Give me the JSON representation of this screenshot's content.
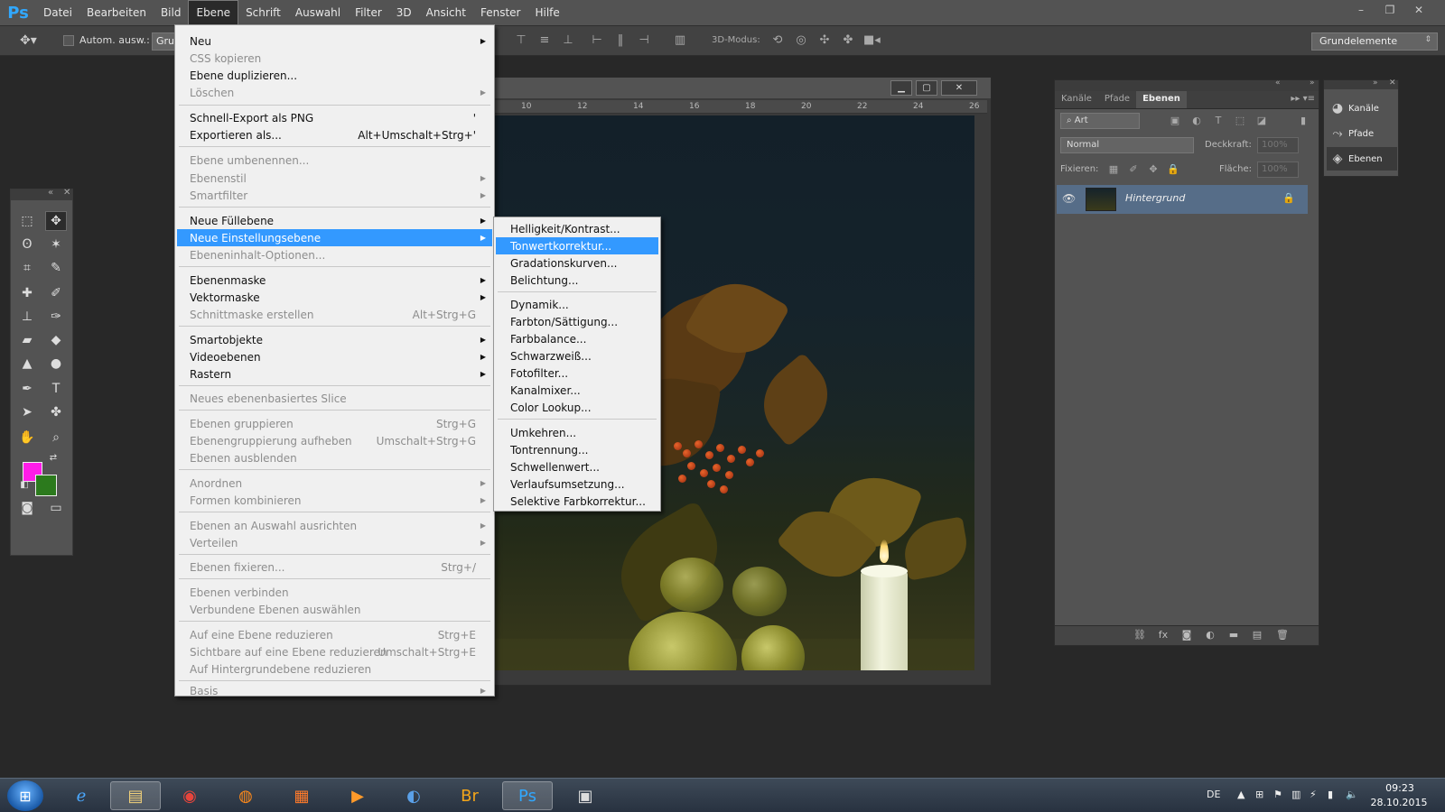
{
  "menubar": {
    "logo": "Ps",
    "items": [
      "Datei",
      "Bearbeiten",
      "Bild",
      "Ebene",
      "Schrift",
      "Auswahl",
      "Filter",
      "3D",
      "Ansicht",
      "Fenster",
      "Hilfe"
    ],
    "active_index": 3
  },
  "window_controls": [
    "–",
    "❐",
    "✕"
  ],
  "options": {
    "auto_select_label": "Autom. ausw.:",
    "group_value": "Grup",
    "mode_3d_label": "3D-Modus:",
    "workspace": "Grundelemente"
  },
  "menu": {
    "items": [
      {
        "label": "Neu",
        "shortcut": "",
        "submenu": true,
        "disabled": false
      },
      {
        "label": "CSS kopieren",
        "shortcut": "",
        "submenu": false,
        "disabled": true
      },
      {
        "label": "Ebene duplizieren...",
        "shortcut": "",
        "submenu": false,
        "disabled": false
      },
      {
        "label": "Löschen",
        "shortcut": "",
        "submenu": true,
        "disabled": true
      },
      {
        "label": "Schnell-Export als PNG",
        "shortcut": "'",
        "submenu": false,
        "disabled": false
      },
      {
        "label": "Exportieren als...",
        "shortcut": "Alt+Umschalt+Strg+'",
        "submenu": false,
        "disabled": false
      },
      {
        "label": "Ebene umbenennen...",
        "shortcut": "",
        "submenu": false,
        "disabled": true
      },
      {
        "label": "Ebenenstil",
        "shortcut": "",
        "submenu": true,
        "disabled": true
      },
      {
        "label": "Smartfilter",
        "shortcut": "",
        "submenu": true,
        "disabled": true
      },
      {
        "label": "Neue Füllebene",
        "shortcut": "",
        "submenu": true,
        "disabled": false
      },
      {
        "label": "Neue Einstellungsebene",
        "shortcut": "",
        "submenu": true,
        "disabled": false,
        "highlighted": true
      },
      {
        "label": "Ebeneninhalt-Optionen...",
        "shortcut": "",
        "submenu": false,
        "disabled": true
      },
      {
        "label": "Ebenenmaske",
        "shortcut": "",
        "submenu": true,
        "disabled": false
      },
      {
        "label": "Vektormaske",
        "shortcut": "",
        "submenu": true,
        "disabled": false
      },
      {
        "label": "Schnittmaske erstellen",
        "shortcut": "Alt+Strg+G",
        "submenu": false,
        "disabled": true
      },
      {
        "label": "Smartobjekte",
        "shortcut": "",
        "submenu": true,
        "disabled": false
      },
      {
        "label": "Videoebenen",
        "shortcut": "",
        "submenu": true,
        "disabled": false
      },
      {
        "label": "Rastern",
        "shortcut": "",
        "submenu": true,
        "disabled": false
      },
      {
        "label": "Neues ebenenbasiertes Slice",
        "shortcut": "",
        "submenu": false,
        "disabled": true
      },
      {
        "label": "Ebenen gruppieren",
        "shortcut": "Strg+G",
        "submenu": false,
        "disabled": true
      },
      {
        "label": "Ebenengruppierung aufheben",
        "shortcut": "Umschalt+Strg+G",
        "submenu": false,
        "disabled": true
      },
      {
        "label": "Ebenen ausblenden",
        "shortcut": "",
        "submenu": false,
        "disabled": true
      },
      {
        "label": "Anordnen",
        "shortcut": "",
        "submenu": true,
        "disabled": true
      },
      {
        "label": "Formen kombinieren",
        "shortcut": "",
        "submenu": true,
        "disabled": true
      },
      {
        "label": "Ebenen an Auswahl ausrichten",
        "shortcut": "",
        "submenu": true,
        "disabled": true
      },
      {
        "label": "Verteilen",
        "shortcut": "",
        "submenu": true,
        "disabled": true
      },
      {
        "label": "Ebenen fixieren...",
        "shortcut": "Strg+/",
        "submenu": false,
        "disabled": true
      },
      {
        "label": "Ebenen verbinden",
        "shortcut": "",
        "submenu": false,
        "disabled": true
      },
      {
        "label": "Verbundene Ebenen auswählen",
        "shortcut": "",
        "submenu": false,
        "disabled": true
      },
      {
        "label": "Auf eine Ebene reduzieren",
        "shortcut": "Strg+E",
        "submenu": false,
        "disabled": true
      },
      {
        "label": "Sichtbare auf eine Ebene reduzieren",
        "shortcut": "Umschalt+Strg+E",
        "submenu": false,
        "disabled": true
      },
      {
        "label": "Auf Hintergrundebene reduzieren",
        "shortcut": "",
        "submenu": false,
        "disabled": true
      },
      {
        "label": "Basis",
        "shortcut": "",
        "submenu": true,
        "disabled": true
      }
    ]
  },
  "submenu": {
    "items": [
      {
        "label": "Helligkeit/Kontrast..."
      },
      {
        "label": "Tonwertkorrektur...",
        "highlighted": true
      },
      {
        "label": "Gradationskurven..."
      },
      {
        "label": "Belichtung..."
      },
      {
        "label": "Dynamik..."
      },
      {
        "label": "Farbton/Sättigung..."
      },
      {
        "label": "Farbbalance..."
      },
      {
        "label": "Schwarzweiß..."
      },
      {
        "label": "Fotofilter..."
      },
      {
        "label": "Kanalmixer..."
      },
      {
        "label": "Color Lookup..."
      },
      {
        "label": "Umkehren..."
      },
      {
        "label": "Tontrennung..."
      },
      {
        "label": "Schwellenwert..."
      },
      {
        "label": "Verlaufsumsetzung..."
      },
      {
        "label": "Selektive Farbkorrektur..."
      }
    ]
  },
  "document": {
    "ruler_ticks": [
      "10",
      "12",
      "14",
      "16",
      "18",
      "20",
      "22",
      "24",
      "26"
    ]
  },
  "tools": {
    "foreground_color": "#ff1ce8",
    "background_color": "#2c7a1d"
  },
  "layers_panel": {
    "tabs": [
      "Kanäle",
      "Pfade",
      "Ebenen"
    ],
    "active_tab": "Ebenen",
    "filter": "Art",
    "blend_mode": "Normal",
    "opacity_label": "Deckkraft:",
    "opacity_value": "100%",
    "lock_label": "Fixieren:",
    "fill_label": "Fläche:",
    "fill_value": "100%",
    "layer_name": "Hintergrund"
  },
  "collapsed_panels": [
    "Kanäle",
    "Pfade",
    "Ebenen"
  ],
  "taskbar": {
    "language": "DE",
    "time": "09:23",
    "date": "28.10.2015"
  }
}
